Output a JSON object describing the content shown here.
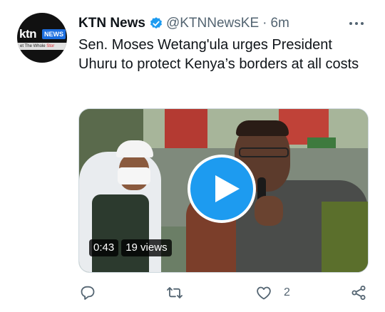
{
  "tweet": {
    "author": {
      "name": "KTN News",
      "handle": "@KTNNewsKE",
      "separator": "·",
      "time": "6m",
      "avatar": {
        "logo_text": "ktn",
        "logo_badge": "NEWS",
        "tagline_prefix": "et The Whole ",
        "tagline_accent": "Stor"
      }
    },
    "text": "Sen. Moses Wetang'ula urges President Uhuru to protect Kenya’s borders at all costs",
    "video": {
      "duration": "0:43",
      "views": "19 views"
    },
    "actions": {
      "reply_count": "",
      "retweet_count": "",
      "like_count": "2",
      "share_label": ""
    }
  },
  "colors": {
    "accent": "#1d9bf0",
    "text": "#0f1419",
    "muted": "#536471"
  },
  "icons": [
    "verified-badge-icon",
    "more-icon",
    "play-icon",
    "reply-icon",
    "retweet-icon",
    "like-icon",
    "share-icon"
  ]
}
